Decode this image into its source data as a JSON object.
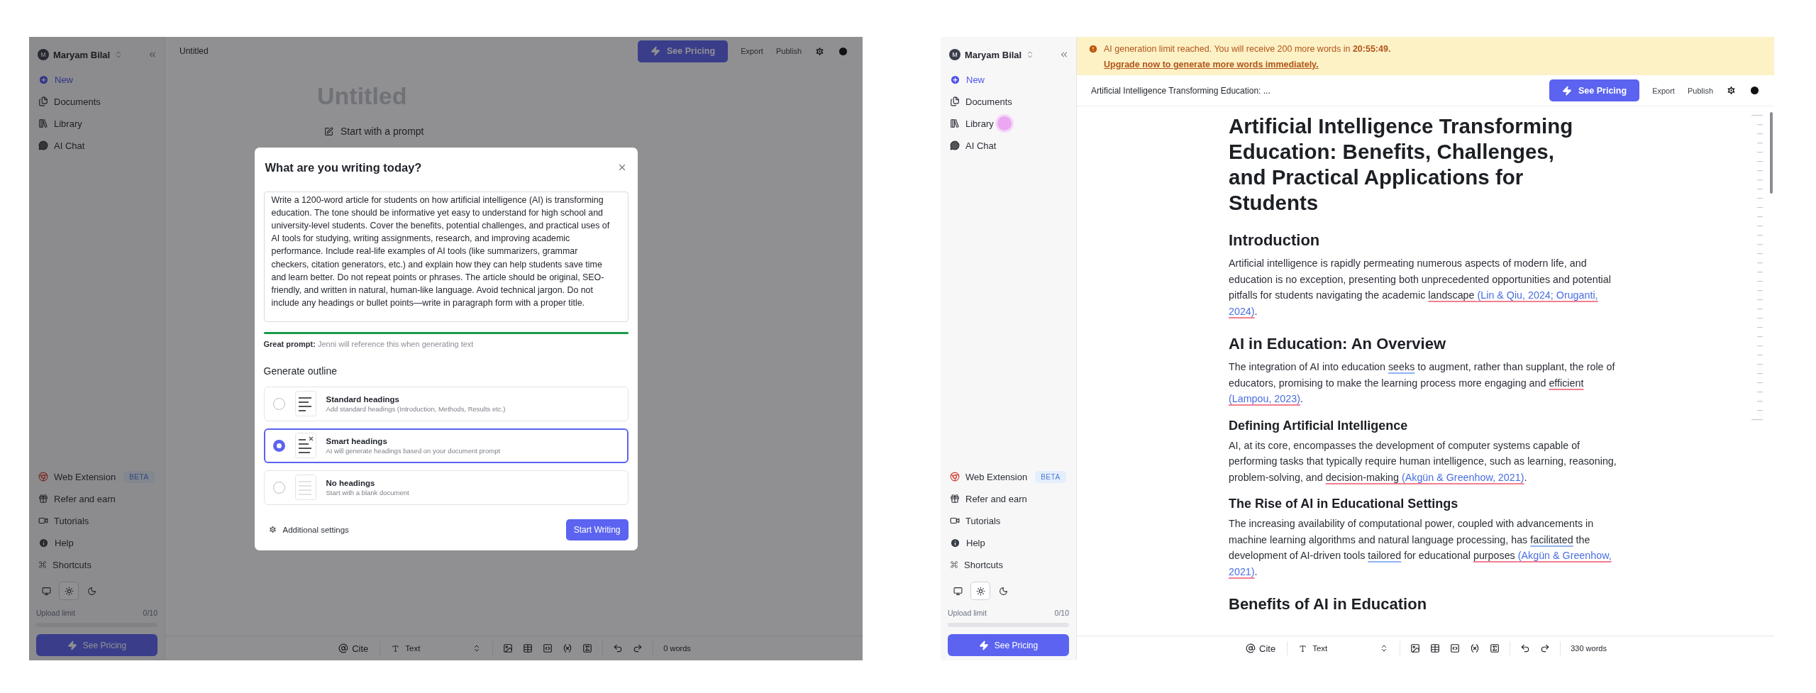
{
  "screens": [
    {
      "kind": "dialog",
      "sidebar": {
        "user": {
          "initial": "M",
          "name": "Maryam Bilal"
        },
        "nav": [
          {
            "kind": "new",
            "label": "New",
            "cursor": false
          },
          {
            "kind": "documents",
            "label": "Documents",
            "cursor": false
          },
          {
            "kind": "library",
            "label": "Library",
            "cursor": false
          },
          {
            "kind": "chat",
            "label": "AI Chat",
            "cursor": false
          }
        ],
        "links": [
          {
            "kind": "extension",
            "label": "Web Extension",
            "badge": "BETA"
          },
          {
            "kind": "refer",
            "label": "Refer and earn"
          },
          {
            "kind": "tutorials",
            "label": "Tutorials"
          },
          {
            "kind": "help",
            "label": "Help"
          },
          {
            "kind": "shortcuts",
            "label": "Shortcuts"
          }
        ],
        "themes": [
          {
            "kind": "system",
            "selected": false
          },
          {
            "kind": "light",
            "selected": true
          },
          {
            "kind": "dark",
            "selected": false
          }
        ],
        "upload": {
          "label": "Upload limit",
          "count": "0/10",
          "level": 0
        },
        "cta": "See Pricing"
      },
      "header": {
        "title": "Untitled",
        "pricing": "See Pricing",
        "actions": [
          "Export",
          "Publish"
        ]
      },
      "document": {
        "title": "Untitled",
        "prompt_link": "Start with a prompt"
      },
      "toolbar": {
        "cite": "Cite",
        "style": "Text",
        "words": "0 words"
      },
      "dialog": {
        "title": "What are you writing today?",
        "prompt": "Write a 1200-word article for students on how artificial intelligence (AI) is transforming education. The tone should be informative yet easy to understand for high school and university-level students. Cover the benefits, potential challenges, and practical uses of AI tools for studying, writing assignments, research, and improving academic performance. Include real-life examples of AI tools (like summarizers, grammar checkers, citation generators, etc.) and explain how they can help students save time and learn better. Do not repeat points or phrases. The article should be original, SEO-friendly, and written in natural, human-like language. Avoid technical jargon. Do not include any headings or bullet points—write in paragraph form with a proper title.",
        "quality": {
          "level": 1,
          "label": "Great prompt:",
          "hint": "Jenni will reference this when generating text"
        },
        "outline_title": "Generate outline",
        "options": [
          {
            "kind": "standard",
            "title": "Standard headings",
            "description": "Add standard headings (Introduction, Methods, Results etc.)",
            "selected": false
          },
          {
            "kind": "smart",
            "title": "Smart headings",
            "description": "AI will generate headings based on your document prompt",
            "selected": true
          },
          {
            "kind": "none",
            "title": "No headings",
            "description": "Start with a blank document",
            "selected": false
          }
        ],
        "settings": "Additional settings",
        "submit": "Start Writing"
      }
    },
    {
      "kind": "document",
      "sidebar": {
        "user": {
          "initial": "M",
          "name": "Maryam Bilal"
        },
        "nav": [
          {
            "kind": "new",
            "label": "New",
            "cursor": false
          },
          {
            "kind": "documents",
            "label": "Documents",
            "cursor": false
          },
          {
            "kind": "library",
            "label": "Library",
            "cursor": true
          },
          {
            "kind": "chat",
            "label": "AI Chat",
            "cursor": false
          }
        ],
        "links": [
          {
            "kind": "extension",
            "label": "Web Extension",
            "badge": "BETA"
          },
          {
            "kind": "refer",
            "label": "Refer and earn"
          },
          {
            "kind": "tutorials",
            "label": "Tutorials"
          },
          {
            "kind": "help",
            "label": "Help"
          },
          {
            "kind": "shortcuts",
            "label": "Shortcuts"
          }
        ],
        "themes": [
          {
            "kind": "system",
            "selected": false
          },
          {
            "kind": "light",
            "selected": true
          },
          {
            "kind": "dark",
            "selected": false
          }
        ],
        "upload": {
          "label": "Upload limit",
          "count": "0/10",
          "level": 0
        },
        "cta": "See Pricing"
      },
      "banner": {
        "message": "AI generation limit reached. You will receive 200 more words in **20:55:49.**",
        "link": "Upgrade now to generate more words immediately."
      },
      "header": {
        "title": "Artificial Intelligence Transforming Education: ...",
        "pricing": "See Pricing",
        "actions": [
          "Export",
          "Publish"
        ]
      },
      "document": {
        "blocks": [
          {
            "kind": "title",
            "text": "Artificial Intelligence Transforming Education: Benefits, Challenges, and Practical Applications for Students"
          },
          {
            "kind": "h2",
            "text": "Introduction"
          },
          {
            "kind": "paragraph",
            "runs": [
              {
                "kind": "plain",
                "text": "Artificial intelligence is rapidly permeating numerous aspects of modern life, and education is no exception, presenting both unprecedented opportunities and potential pitfalls for students navigating the academic "
              },
              {
                "kind": "flag",
                "text": "landscape "
              },
              {
                "kind": "citation",
                "text": "(Lin & Qiu, 2024; Oruganti, 2024)"
              },
              {
                "kind": "plain",
                "text": "."
              }
            ]
          },
          {
            "kind": "h2",
            "text": "AI in Education: An Overview"
          },
          {
            "kind": "paragraph",
            "runs": [
              {
                "kind": "plain",
                "text": "The integration of AI into education "
              },
              {
                "kind": "grammar",
                "text": "seeks"
              },
              {
                "kind": "plain",
                "text": " to augment, rather than supplant, the role of educators, promising to make the learning process more engaging and "
              },
              {
                "kind": "flag",
                "text": "efficient "
              },
              {
                "kind": "citation",
                "text": "(Lampou, 2023)"
              },
              {
                "kind": "plain",
                "text": "."
              }
            ]
          },
          {
            "kind": "h3",
            "text": "Defining Artificial Intelligence"
          },
          {
            "kind": "paragraph",
            "runs": [
              {
                "kind": "plain",
                "text": "AI, at its core, encompasses the development of computer systems capable of performing tasks that typically require human intelligence, such as learning, reasoning, problem-solving, and "
              },
              {
                "kind": "flag",
                "text": "decision-making "
              },
              {
                "kind": "citation",
                "text": "(Akgün & Greenhow, 2021)"
              },
              {
                "kind": "plain",
                "text": "."
              }
            ]
          },
          {
            "kind": "h3",
            "text": "The Rise of AI in Educational Settings"
          },
          {
            "kind": "paragraph",
            "runs": [
              {
                "kind": "plain",
                "text": "The increasing availability of computational power, coupled with advancements in machine learning algorithms and natural language processing, has "
              },
              {
                "kind": "grammar",
                "text": "facilitated"
              },
              {
                "kind": "plain",
                "text": " the development of AI-driven tools "
              },
              {
                "kind": "grammar",
                "text": "tailored"
              },
              {
                "kind": "plain",
                "text": " for educational "
              },
              {
                "kind": "flag",
                "text": "purposes "
              },
              {
                "kind": "citation",
                "text": "(Akgün & Greenhow, 2021)"
              },
              {
                "kind": "plain",
                "text": "."
              }
            ]
          },
          {
            "kind": "h2",
            "text": "Benefits of AI in Education"
          }
        ]
      },
      "toolbar": {
        "cite": "Cite",
        "style": "Text",
        "words": "330 words"
      }
    }
  ]
}
